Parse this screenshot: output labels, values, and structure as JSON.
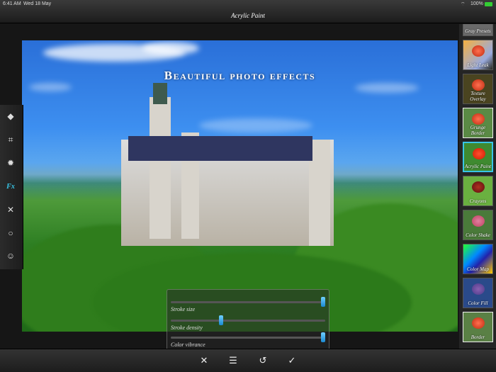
{
  "status_bar": {
    "time": "6:41 AM",
    "date": "Wed 18 May",
    "battery": "100%"
  },
  "header": {
    "title": "Acrylic Paint"
  },
  "photo": {
    "headline": "Beautiful photo effects"
  },
  "left_toolbar": {
    "items": [
      {
        "icon": "layers-icon",
        "glyph": "◆"
      },
      {
        "icon": "crop-icon",
        "glyph": "⌗"
      },
      {
        "icon": "brightness-icon",
        "glyph": "✹"
      },
      {
        "icon": "fx-icon",
        "glyph": "Fx",
        "active": true
      },
      {
        "icon": "tools-icon",
        "glyph": "✕"
      },
      {
        "icon": "vignette-icon",
        "glyph": "○"
      },
      {
        "icon": "mask-icon",
        "glyph": "☺"
      }
    ]
  },
  "effects": [
    {
      "label": "Gray Presets"
    },
    {
      "label": "Light Leak"
    },
    {
      "label": "Texture Overlay"
    },
    {
      "label": "Grunge Border"
    },
    {
      "label": "Acrylic Paint",
      "selected": true
    },
    {
      "label": "Crayons"
    },
    {
      "label": "Color Shake"
    },
    {
      "label": "Color Map"
    },
    {
      "label": "Color Fill"
    },
    {
      "label": "Border"
    }
  ],
  "sliders": [
    {
      "label": "Stroke size",
      "value": 1.0
    },
    {
      "label": "Stroke density",
      "value": 0.32
    },
    {
      "label": "Color vibrance",
      "value": 1.0
    }
  ],
  "bottom_bar": {
    "cancel": "✕",
    "adjust": "☰",
    "reset": "↺",
    "apply": "✓"
  },
  "colors": {
    "accent": "#38c5e6",
    "knob": "#1a88d0"
  }
}
